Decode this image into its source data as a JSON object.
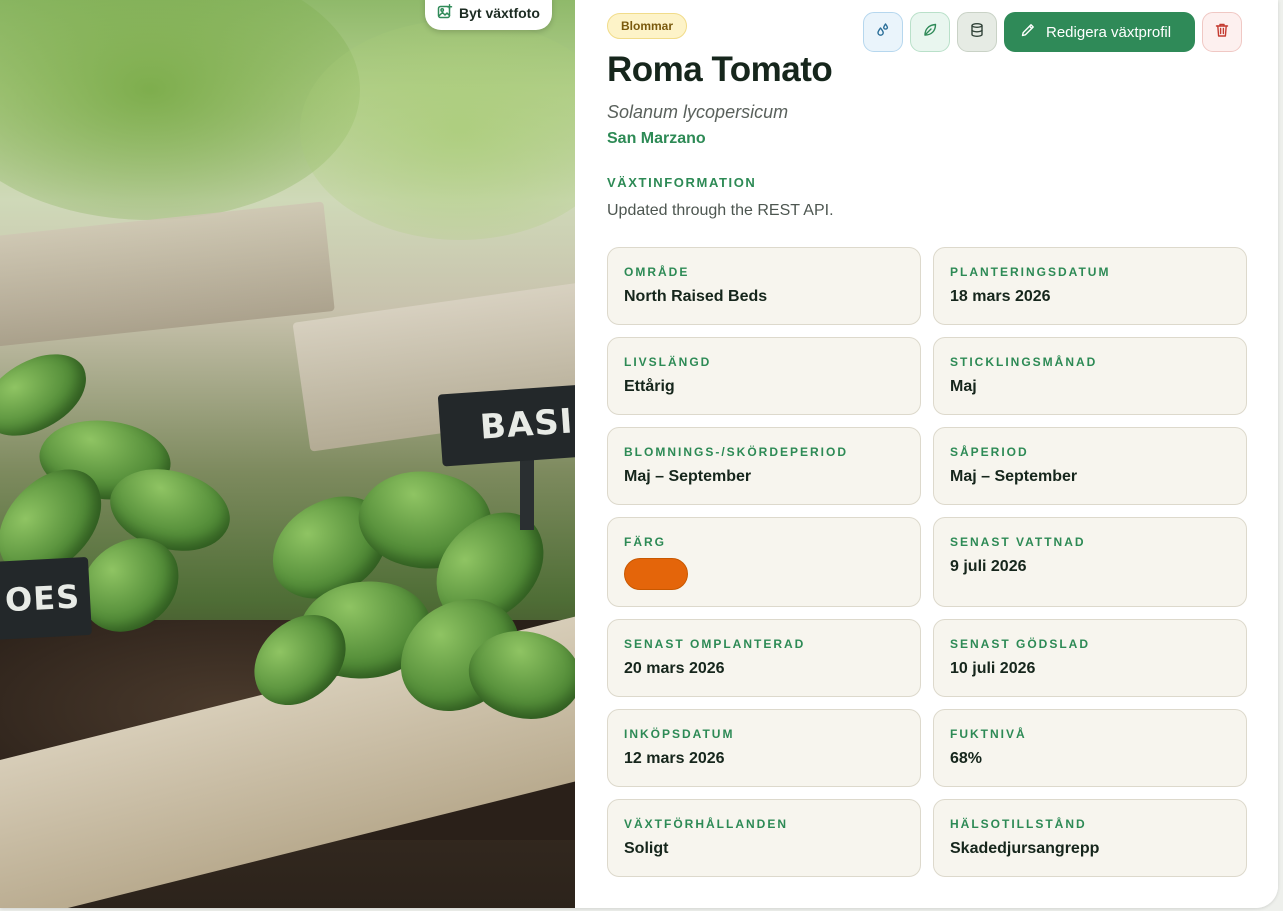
{
  "photo": {
    "change_photo_label": "Byt växtfoto",
    "tag_basil": "BASIL",
    "tag_tomatoes": "OES"
  },
  "plant": {
    "category_badge": "Blommar",
    "name": "Roma Tomato",
    "scientific_name": "Solanum lycopersicum",
    "cultivar": "San Marzano",
    "section_label": "VÄXTINFORMATION",
    "description": "Updated through the REST API."
  },
  "actions": {
    "water_icon": "water-drops-icon",
    "fertilize_icon": "leaf-icon",
    "data_icon": "database-icon",
    "edit_label": "Redigera växtprofil",
    "edit_icon": "pencil-icon",
    "delete_icon": "trash-icon"
  },
  "details": [
    {
      "label": "OMRÅDE",
      "value": "North Raised Beds"
    },
    {
      "label": "PLANTERINGSDATUM",
      "value": "18 mars 2026"
    },
    {
      "label": "LIVSLÄNGD",
      "value": "Ettårig"
    },
    {
      "label": "STICKLINGSMÅNAD",
      "value": "Maj"
    },
    {
      "label": "BLOMNINGS-/SKÖRDEPERIOD",
      "value": "Maj – September"
    },
    {
      "label": "SÅPERIOD",
      "value": "Maj – September"
    },
    {
      "label": "FÄRG",
      "color": "#e4650a"
    },
    {
      "label": "SENAST VATTNAD",
      "value": "9 juli 2026"
    },
    {
      "label": "SENAST OMPLANTERAD",
      "value": "20 mars 2026"
    },
    {
      "label": "SENAST GÖDSLAD",
      "value": "10 juli 2026"
    },
    {
      "label": "INKÖPSDATUM",
      "value": "12 mars 2026"
    },
    {
      "label": "FUKTNIVÅ",
      "value": "68%"
    },
    {
      "label": "VÄXTFÖRHÅLLANDEN",
      "value": "Soligt"
    },
    {
      "label": "HÄLSOTILLSTÅND",
      "value": "Skadedjursangrepp"
    }
  ],
  "colors": {
    "accent": "#2f8a58",
    "title": "#16261c",
    "card_bg": "#f7f5ee",
    "badge_bg": "#fdf3c8"
  }
}
